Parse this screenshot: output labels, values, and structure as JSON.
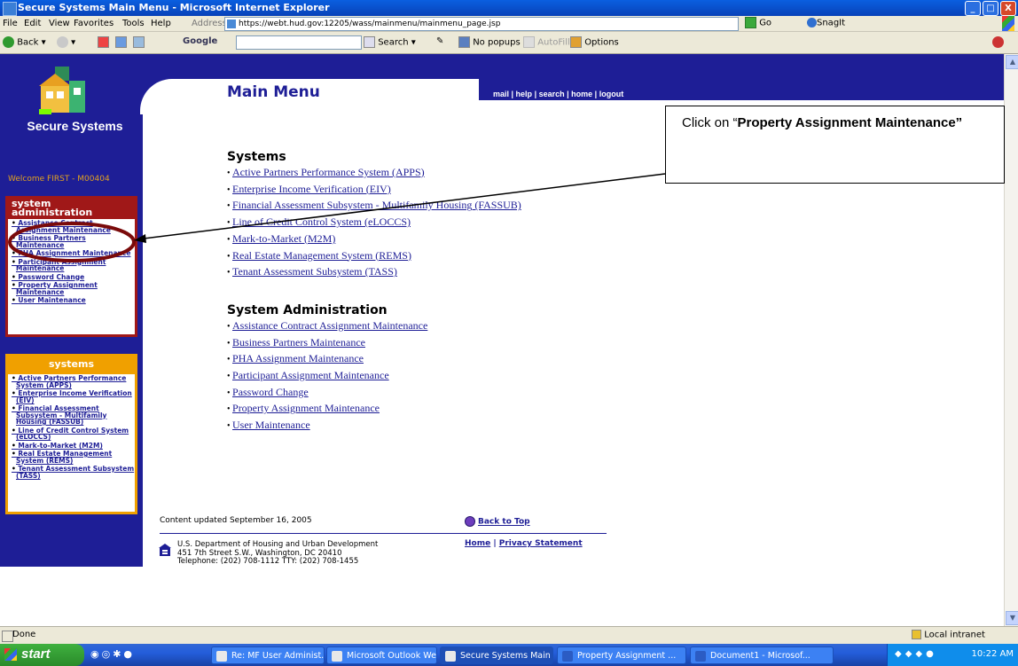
{
  "window": {
    "title": "Secure Systems Main Menu - Microsoft Internet Explorer",
    "buttons": [
      "_",
      "□",
      "X"
    ]
  },
  "menubar": {
    "items": [
      "File",
      "Edit",
      "View",
      "Favorites",
      "Tools",
      "Help"
    ],
    "address_label": "Address",
    "address_value": "https://webt.hud.gov:12205/wass/mainmenu/mainmenu_page.jsp",
    "go_label": "Go",
    "snagit_label": "SnagIt"
  },
  "toolbar": {
    "back_label": "Back",
    "google_label": "Google",
    "search_label": "Search",
    "popups_label": "No popups",
    "autofill_label": "AutoFill",
    "options_label": "Options"
  },
  "page": {
    "title": "Main Menu",
    "nav": [
      "mail",
      "help",
      "search",
      "home",
      "logout"
    ],
    "logo_text": "Secure Systems",
    "welcome": "Welcome FIRST - M00404",
    "admin_box": {
      "header": "system administration",
      "links": [
        "Assistance Contract Assignment Maintenance",
        "Business Partners Maintenance",
        "PHA Assignment Maintenance",
        "Participant Assignment Maintenance",
        "Password Change",
        "Property Assignment Maintenance",
        "User Maintenance"
      ]
    },
    "systems_box": {
      "header": "systems",
      "links": [
        "Active Partners Performance System (APPS)",
        "Enterprise Income Verification (EIV)",
        "Financial Assessment Subsystem - Multifamily Housing (FASSUB)",
        "Line of Credit Control System (eLOCCS)",
        "Mark-to-Market (M2M)",
        "Real Estate Management System (REMS)",
        "Tenant Assessment Subsystem (TASS)"
      ]
    },
    "systems_section": {
      "title": "Systems",
      "links": [
        "Active Partners Performance System (APPS)",
        "Enterprise Income Verification (EIV)",
        "Financial Assessment Subsystem - Multifamily Housing (FASSUB)",
        "Line of Credit Control System (eLOCCS)",
        "Mark-to-Market (M2M)",
        "Real Estate Management System (REMS)",
        "Tenant Assessment Subsystem (TASS)"
      ]
    },
    "admin_section": {
      "title": "System Administration",
      "links": [
        "Assistance Contract Assignment Maintenance",
        "Business Partners Maintenance",
        "PHA Assignment Maintenance",
        "Participant Assignment Maintenance",
        "Password Change",
        "Property Assignment Maintenance",
        "User Maintenance"
      ]
    },
    "footer": {
      "updated": "Content updated September 16, 2005",
      "back_to_top": "Back to Top",
      "address": "U.S. Department of Housing and Urban Development\n451 7th Street S.W., Washington, DC 20410\nTelephone: (202) 708-1112 TTY: (202) 708-1455",
      "home": "Home",
      "privacy": "Privacy Statement"
    }
  },
  "callout": {
    "prefix": "Click on “",
    "bold": "Property Assignment Maintenance”"
  },
  "statusbar": {
    "status": "Done",
    "zone": "Local intranet"
  },
  "taskbar": {
    "start_label": "start",
    "buttons": [
      "Re: MF User Administ...",
      "Microsoft Outlook We...",
      "Secure Systems Main ...",
      "Property Assignment ...",
      "Document1 - Microsof..."
    ],
    "clock": "10:22 AM"
  },
  "colors": {
    "hud_blue": "#1E1E96",
    "admin_red": "#A01818",
    "systems_orange": "#F0A000",
    "callout_ring": "#7A0A0A"
  }
}
